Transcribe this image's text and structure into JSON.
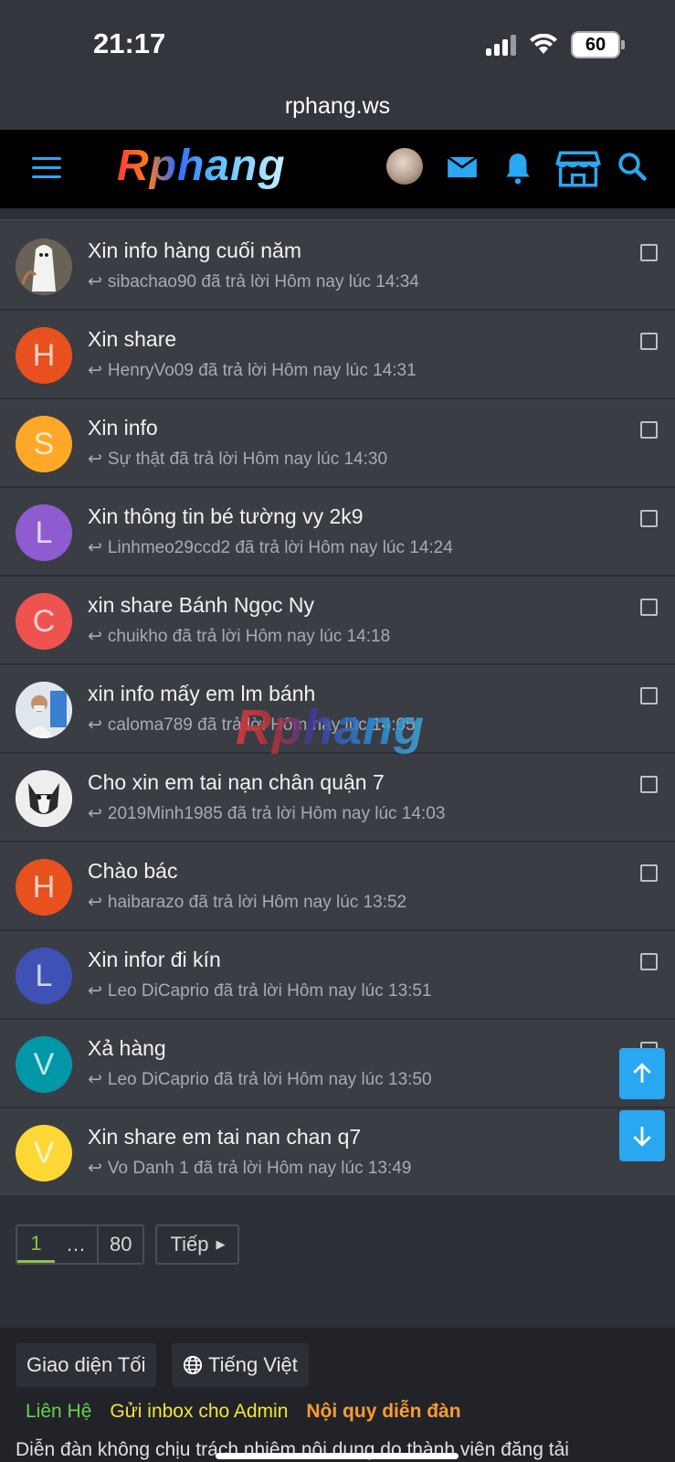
{
  "status_bar": {
    "time": "21:17",
    "battery": "60"
  },
  "browser": {
    "url": "rphang.ws"
  },
  "navbar": {
    "logo": "Rphang"
  },
  "colors": {
    "accent": "#29a7f0",
    "background": "#2c2f36",
    "row": "#3a3d44",
    "navbar": "#000000"
  },
  "threads": [
    {
      "title": "Xin info hàng cuối năm",
      "meta": "sibachao90 đã trả lời Hôm nay lúc 14:34",
      "avatar_letter": "",
      "avatar_color": "#5b5e66",
      "avatar_type": "photo"
    },
    {
      "title": "Xin share",
      "meta": "HenryVo09 đã trả lời Hôm nay lúc 14:31",
      "avatar_letter": "H",
      "avatar_color": "#e8501e"
    },
    {
      "title": "Xin info",
      "meta": "Sự thật đã trả lời Hôm nay lúc 14:30",
      "avatar_letter": "S",
      "avatar_color": "#ffa726"
    },
    {
      "title": "Xin thông tin bé tường vy 2k9",
      "meta": "Linhmeo29ccd2 đã trả lời Hôm nay lúc 14:24",
      "avatar_letter": "L",
      "avatar_color": "#8e5bd1"
    },
    {
      "title": "xin share Bánh Ngọc Ny",
      "meta": "chuikho đã trả lời Hôm nay lúc 14:18",
      "avatar_letter": "C",
      "avatar_color": "#ef5350"
    },
    {
      "title": "xin info mấy em lm bánh",
      "meta": "caloma789 đã trả lời Hôm nay lúc 14:05",
      "avatar_letter": "",
      "avatar_color": "#c9d4e0",
      "avatar_type": "photo"
    },
    {
      "title": "Cho xin em tai nạn chân quận 7",
      "meta": "2019Minh1985 đã trả lời Hôm nay lúc 14:03",
      "avatar_letter": "",
      "avatar_color": "#e6e6e6",
      "avatar_type": "photo"
    },
    {
      "title": "Chào bác",
      "meta": "haibarazo đã trả lời Hôm nay lúc 13:52",
      "avatar_letter": "H",
      "avatar_color": "#e8501e"
    },
    {
      "title": "Xin infor đi kín",
      "meta": "Leo DiCaprio đã trả lời Hôm nay lúc 13:51",
      "avatar_letter": "L",
      "avatar_color": "#3f51b5"
    },
    {
      "title": "Xả hàng",
      "meta": "Leo DiCaprio đã trả lời Hôm nay lúc 13:50",
      "avatar_letter": "V",
      "avatar_color": "#0097a7"
    },
    {
      "title": "Xin share em tai nan chan q7",
      "meta": "Vo Danh 1 đã trả lời Hôm nay lúc 13:49",
      "avatar_letter": "V",
      "avatar_color": "#fdd835"
    }
  ],
  "watermark": "Rphang",
  "pagination": {
    "current": "1",
    "ellipsis": "…",
    "last": "80",
    "next": "Tiếp"
  },
  "footer": {
    "theme_button": "Giao diện Tối",
    "language_button": "Tiếng Việt",
    "links": [
      {
        "label": "Liên Hệ",
        "color": "#66d14a"
      },
      {
        "label": "Gửi inbox cho Admin",
        "color": "#f7e433"
      },
      {
        "label": "Nội quy diễn đàn",
        "color": "#ff9b30"
      }
    ],
    "disclaimer": "Diễn đàn không chịu trách nhiệm nội dung do thành viên đăng tải"
  }
}
